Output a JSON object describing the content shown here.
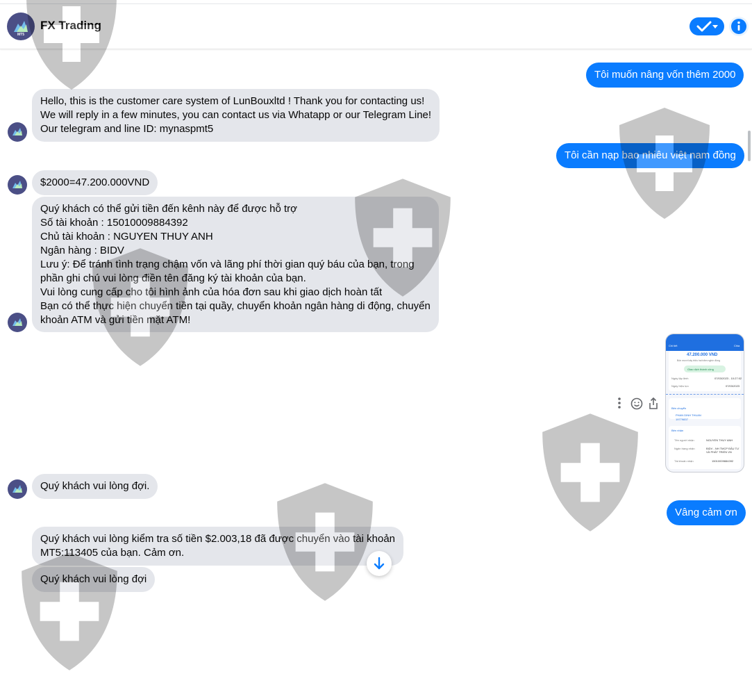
{
  "header": {
    "title": "FX Trading",
    "logo_text": "MT5"
  },
  "messages": [
    {
      "from": "user",
      "text": "Tôi muốn nâng vốn thêm 2000"
    },
    {
      "from": "page",
      "lines": [
        "Hello, this is the customer care system of  LunBouxltd ! Thank you for contacting us!",
        "We will reply in a few minutes, you can contact us via Whatapp or our Telegram Line!",
        "Our telegram and line ID: mynaspmt5"
      ]
    },
    {
      "from": "user",
      "text": "Tôi cần nạp bao nhiêu việt nam đồng"
    },
    {
      "from": "page",
      "text": "$2000=47.200.000VND"
    },
    {
      "from": "page",
      "lines": [
        "Quý khách có thể gửi tiền đến kênh này để được hỗ trợ",
        "Số tài khoản : 15010009884392",
        "Chủ tài khoản : NGUYEN THUY ANH",
        "Ngân hàng : BIDV",
        "Lưu ý: Để tránh tình trạng chậm vốn và lãng phí thời gian quý báu của bạn, trong",
        "phần ghi chú vui lòng điền tên đăng ký tài khoản của bạn.",
        "Vui lòng cung cấp cho tôi hình ảnh của hóa đơn sau khi giao dịch hoàn tất",
        "Bạn có thể thực hiện chuyển tiền tại quầy, chuyển khoản ngân hàng di động, chuyển",
        "khoản ATM và gửi tiền mặt ATM!"
      ]
    },
    {
      "from": "page",
      "text": "Quý khách vui lòng đợi."
    },
    {
      "from": "user",
      "text": "Vâng cảm ơn"
    },
    {
      "from": "page",
      "lines": [
        "Quý khách vui lòng kiểm tra số tiền $2.003,18 đã được chuyển vào tài khoản",
        "MT5:113405 của bạn. Cảm ơn."
      ]
    },
    {
      "from": "page",
      "text": "Quý khách vui lòng đợi"
    }
  ],
  "receipt": {
    "back": "Chi tiết",
    "share": "Chia",
    "amount": "47.200.000 VND",
    "subtitle": "Bốn mươi bảy triệu hai trăm nghìn đồng",
    "status": "Giao dịch thành công",
    "rows": [
      {
        "label": "Ngày lập lệnh",
        "value": "07/03/2023 - 10:27:02"
      },
      {
        "label": "Ngày hiệu lực",
        "value": "07/03/2023"
      }
    ],
    "from_label": "Bên chuyển",
    "from_name": "PHAN DINH THUAN",
    "from_account": "19779837",
    "to_label": "Bên nhận",
    "to_rows": [
      {
        "label": "Tên người nhận",
        "value": "NGUYEN THUY ANH"
      },
      {
        "label": "Ngân hàng nhận",
        "value": "BIDV - NH TMCP ĐẦU TƯ VÀ PHÁT TRIỂN VN"
      },
      {
        "label": "Tài khoản nhận",
        "value": "15010009884392"
      }
    ]
  },
  "colors": {
    "accent": "#0a7cff",
    "incoming_bubble": "#e4e6eb",
    "avatar": "#4b4f86"
  },
  "icons": [
    "check-icon",
    "dropdown-caret-icon",
    "info-icon",
    "more-icon",
    "emoji-icon",
    "share-icon",
    "arrow-down-icon",
    "shield-watermark-icon"
  ]
}
